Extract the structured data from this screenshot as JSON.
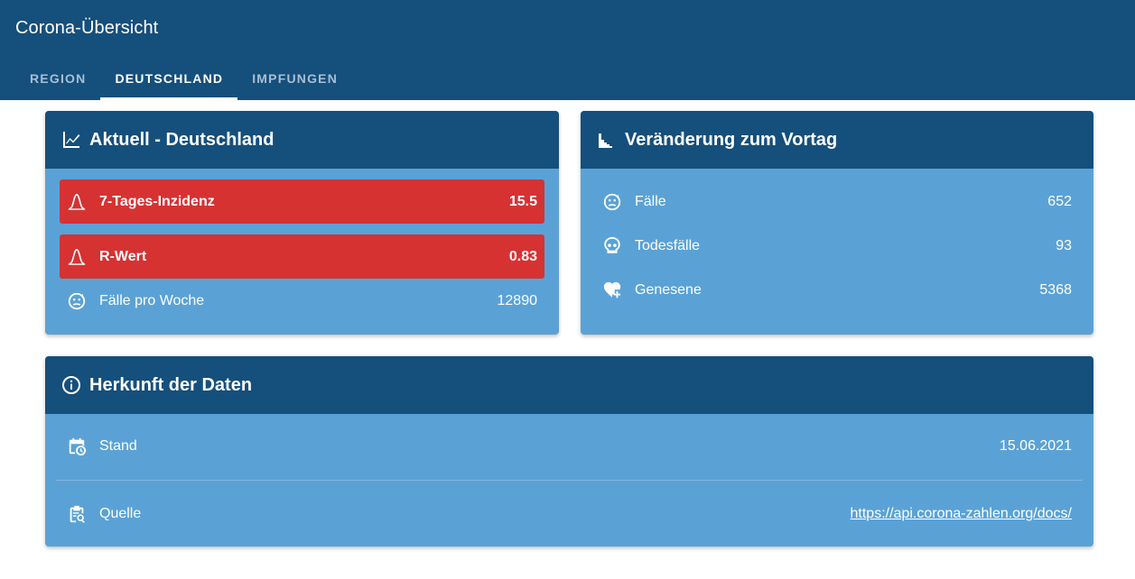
{
  "app": {
    "title": "Corona-Übersicht"
  },
  "tabs": [
    {
      "label": "REGION"
    },
    {
      "label": "DEUTSCHLAND"
    },
    {
      "label": "IMPFUNGEN"
    }
  ],
  "aktuell": {
    "title": "Aktuell - Deutschland",
    "rows": [
      {
        "label": "7-Tages-Inzidenz",
        "value": "15.5",
        "icon": "bell-curve-icon",
        "alert": true
      },
      {
        "label": "R-Wert",
        "value": "0.83",
        "icon": "bell-curve-icon",
        "alert": true
      },
      {
        "label": "Fälle pro Woche",
        "value": "12890",
        "icon": "sick-face-icon",
        "alert": false
      }
    ]
  },
  "vortag": {
    "title": "Veränderung zum Vortag",
    "rows": [
      {
        "label": "Fälle",
        "value": "652",
        "icon": "sick-face-icon"
      },
      {
        "label": "Todesfälle",
        "value": "93",
        "icon": "skull-icon"
      },
      {
        "label": "Genesene",
        "value": "5368",
        "icon": "heart-plus-icon"
      }
    ]
  },
  "herkunft": {
    "title": "Herkunft der Daten",
    "stand_label": "Stand",
    "stand_value": "15.06.2021",
    "quelle_label": "Quelle",
    "quelle_value": "https://api.corona-zahlen.org/docs/"
  },
  "colors": {
    "header": "#154f7c",
    "card_body": "#5aa2d6",
    "alert": "#d63232"
  }
}
